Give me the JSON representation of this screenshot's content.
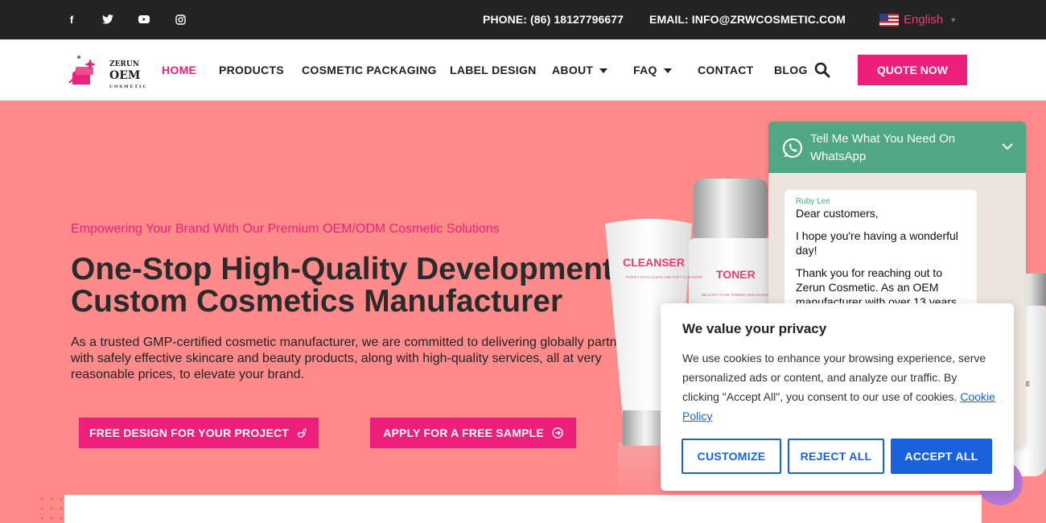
{
  "topbar": {
    "social": [
      {
        "icon": "facebook-icon",
        "glyph": "f"
      },
      {
        "icon": "twitter-icon",
        "glyph": "🐦"
      },
      {
        "icon": "youtube-icon",
        "glyph": "▶"
      },
      {
        "icon": "instagram-icon",
        "glyph": "◎"
      }
    ],
    "phone": "PHONE: (86) 18127796677",
    "email": "EMAIL: INFO@ZRWCOSMETIC.COM",
    "language": "English"
  },
  "header": {
    "logo": {
      "line1": "ZERUN",
      "line2": "OEM",
      "line3": "COSMETIC"
    },
    "nav": [
      {
        "label": "HOME",
        "active": true
      },
      {
        "label": "PRODUCTS"
      },
      {
        "label": "COSMETIC PACKAGING"
      },
      {
        "label": "LABEL DESIGN"
      },
      {
        "label": "ABOUT",
        "dropdown": true
      },
      {
        "label": "FAQ",
        "dropdown": true
      },
      {
        "label": "CONTACT"
      },
      {
        "label": "BLOG"
      }
    ],
    "quote_label": "QUOTE NOW"
  },
  "hero": {
    "tagline": "Empowering Your Brand With Our Premium OEM/ODM Cosmetic Solutions",
    "title": "One-Stop High-Quality Development & Custom Cosmetics Manufacturer",
    "description": "As a trusted GMP-certified cosmetic manufacturer, we are committed to delivering globally partners with safely effective skincare and beauty products, along with high-quality services, all at very reasonable prices, to elevate your brand.",
    "cta_primary": "FREE DESIGN FOR YOUR PROJECT",
    "cta_secondary": "APPLY FOR A FREE SAMPLE",
    "products": {
      "cleanser": "CLEANSER",
      "cleanser_sub": "PURIFY FACE CLEAN AND SOFT CLEANSER",
      "toner": "TONER",
      "toner_sub": "BEAUTIFY FACE TENDER SKIN ESSENCE TONER",
      "essence": "ENCE"
    }
  },
  "whatsapp": {
    "title": "Tell Me What You Need On WhatsApp",
    "sender": "Ruby Lee",
    "messages": [
      "Dear customers,",
      "I hope you're having a wonderful day!",
      "Thank you for reaching out to Zerun Cosmetic. As an OEM manufacturer with over 13 years"
    ]
  },
  "cookie": {
    "title": "We value your privacy",
    "text": "We use cookies to enhance your browsing experience, serve personalized ads or content, and analyze our traffic. By clicking \"Accept All\", you consent to our use of cookies.",
    "link": "Cookie Policy",
    "customize": "CUSTOMIZE",
    "reject": "REJECT ALL",
    "accept": "ACCEPT ALL"
  },
  "colors": {
    "brand": "#ee1f7a",
    "hero_bg": "#ff8a8a",
    "whatsapp": "#4fa883",
    "cookie_blue": "#1863dc"
  }
}
